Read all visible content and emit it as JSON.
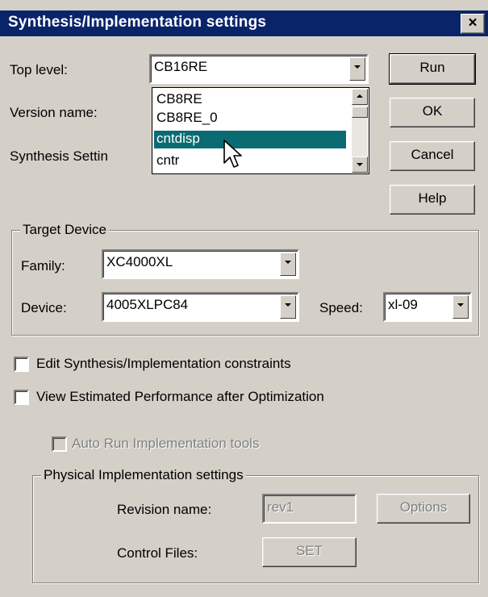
{
  "window": {
    "title": "Synthesis/Implementation settings",
    "close_label": "×"
  },
  "top_level": {
    "label": "Top level:",
    "value": "CB16RE",
    "dropdown_items": [
      "CB8RE",
      "CB8RE_0",
      "cntdisp",
      "cntr"
    ],
    "selected_item": "cntdisp"
  },
  "version_name": {
    "label": "Version name:"
  },
  "synthesis_settings": {
    "label": "Synthesis Settin"
  },
  "buttons": {
    "run": "Run",
    "ok": "OK",
    "cancel": "Cancel",
    "help": "Help"
  },
  "target_device": {
    "title": "Target Device",
    "family_label": "Family:",
    "family_value": "XC4000XL",
    "device_label": "Device:",
    "device_value": "4005XLPC84",
    "speed_label": "Speed:",
    "speed_value": "xl-09"
  },
  "options": {
    "edit_constraints": "Edit Synthesis/Implementation constraints",
    "view_performance": "View Estimated Performance after Optimization",
    "auto_run": "Auto Run Implementation tools"
  },
  "physical": {
    "title": "Physical Implementation settings",
    "revision_label": "Revision name:",
    "revision_value": "rev1",
    "options_button": "Options",
    "control_label": "Control Files:",
    "set_button": "SET"
  }
}
